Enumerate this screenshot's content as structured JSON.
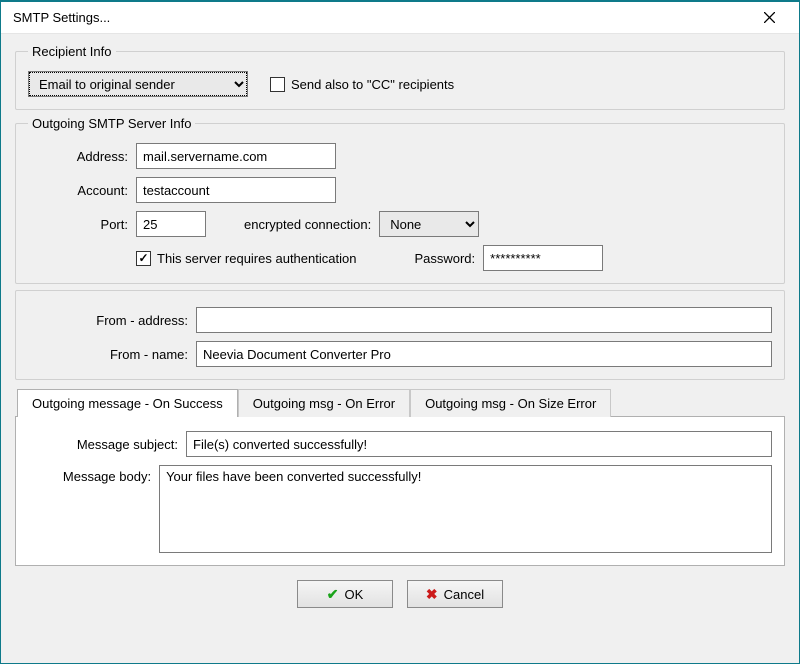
{
  "window": {
    "title": "SMTP Settings..."
  },
  "recipient": {
    "legend": "Recipient Info",
    "emailTo": {
      "selected": "Email to original sender"
    },
    "sendAlso": {
      "label": "Send also to \"CC\" recipients",
      "checked": false
    }
  },
  "server": {
    "legend": "Outgoing SMTP Server Info",
    "addressLabel": "Address:",
    "address": "mail.servername.com",
    "accountLabel": "Account:",
    "account": "testaccount",
    "portLabel": "Port:",
    "port": "25",
    "encLabel": "encrypted connection:",
    "encSelected": "None",
    "requiresAuth": {
      "label": "This server requires authentication",
      "checked": true
    },
    "passwordLabel": "Password:",
    "password": "**********"
  },
  "from": {
    "addressLabel": "From - address:",
    "address": "",
    "nameLabel": "From - name:",
    "name": "Neevia Document Converter Pro"
  },
  "tabs": {
    "success": "Outgoing message - On Success",
    "error": "Outgoing msg - On Error",
    "sizeError": "Outgoing msg - On Size Error"
  },
  "message": {
    "subjectLabel": "Message subject:",
    "subject": "File(s) converted successfully!",
    "bodyLabel": "Message body:",
    "body": "Your files have been converted successfully!"
  },
  "buttons": {
    "ok": "OK",
    "cancel": "Cancel"
  }
}
